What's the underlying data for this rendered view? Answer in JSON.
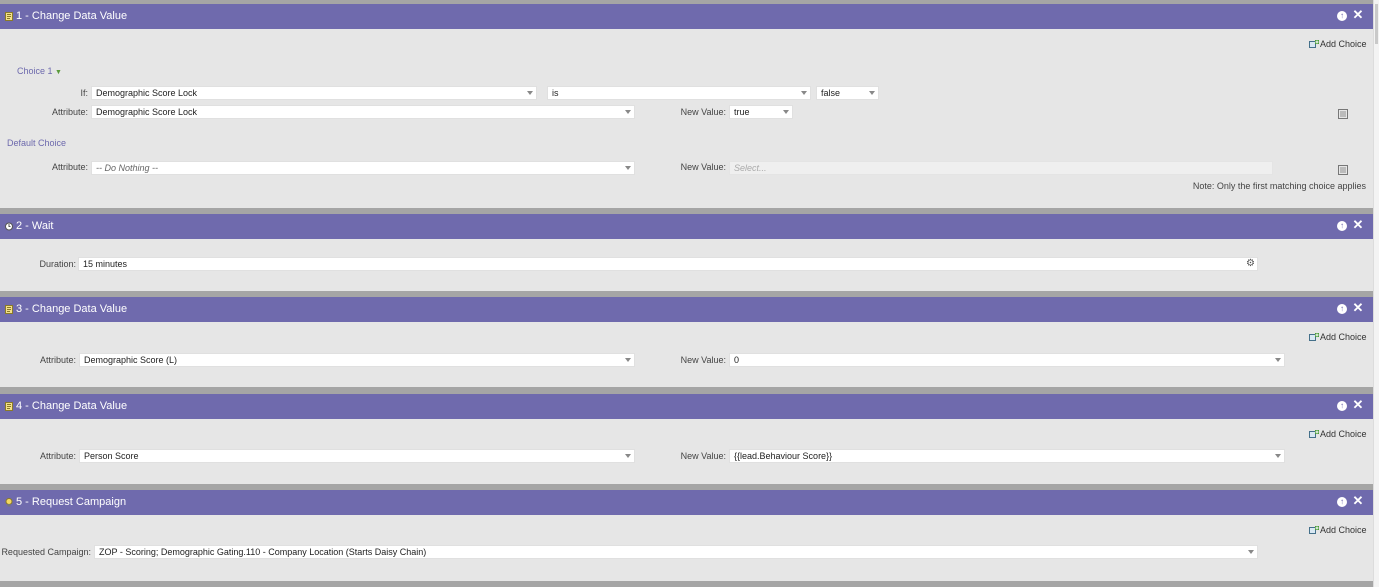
{
  "colors": {
    "header": "#6f6aad",
    "panel": "#e6e6e6",
    "separator": "#a5a5a5",
    "link": "#6d69ad"
  },
  "steps": [
    {
      "title": "1 - Change Data Value",
      "icon": "change-data-value-icon",
      "add_choice": "Add Choice",
      "choice_label": "Choice 1",
      "if_label": "If:",
      "if_attribute": "Demographic Score Lock",
      "operator": "is",
      "compare_value": "false",
      "attribute_label": "Attribute:",
      "attribute": "Demographic Score Lock",
      "new_value_label": "New Value:",
      "new_value": "true",
      "default_choice_label": "Default Choice",
      "default_attribute_label": "Attribute:",
      "default_attribute": "-- Do Nothing --",
      "default_new_value_label": "New Value:",
      "default_new_value_placeholder": "Select...",
      "note": "Note: Only the first matching choice applies"
    },
    {
      "title": "2 - Wait",
      "icon": "wait-icon",
      "duration_label": "Duration:",
      "duration": "15 minutes"
    },
    {
      "title": "3 - Change Data Value",
      "icon": "change-data-value-icon",
      "add_choice": "Add Choice",
      "attribute_label": "Attribute:",
      "attribute": "Demographic Score (L)",
      "new_value_label": "New Value:",
      "new_value": "0"
    },
    {
      "title": "4 - Change Data Value",
      "icon": "change-data-value-icon",
      "add_choice": "Add Choice",
      "attribute_label": "Attribute:",
      "attribute": "Person Score",
      "new_value_label": "New Value:",
      "new_value": "{{lead.Behaviour Score}}"
    },
    {
      "title": "5 - Request Campaign",
      "icon": "request-campaign-icon",
      "add_choice": "Add Choice",
      "campaign_label": "Requested Campaign:",
      "campaign": "ZOP - Scoring; Demographic Gating.110 - Company Location (Starts Daisy Chain)"
    }
  ]
}
